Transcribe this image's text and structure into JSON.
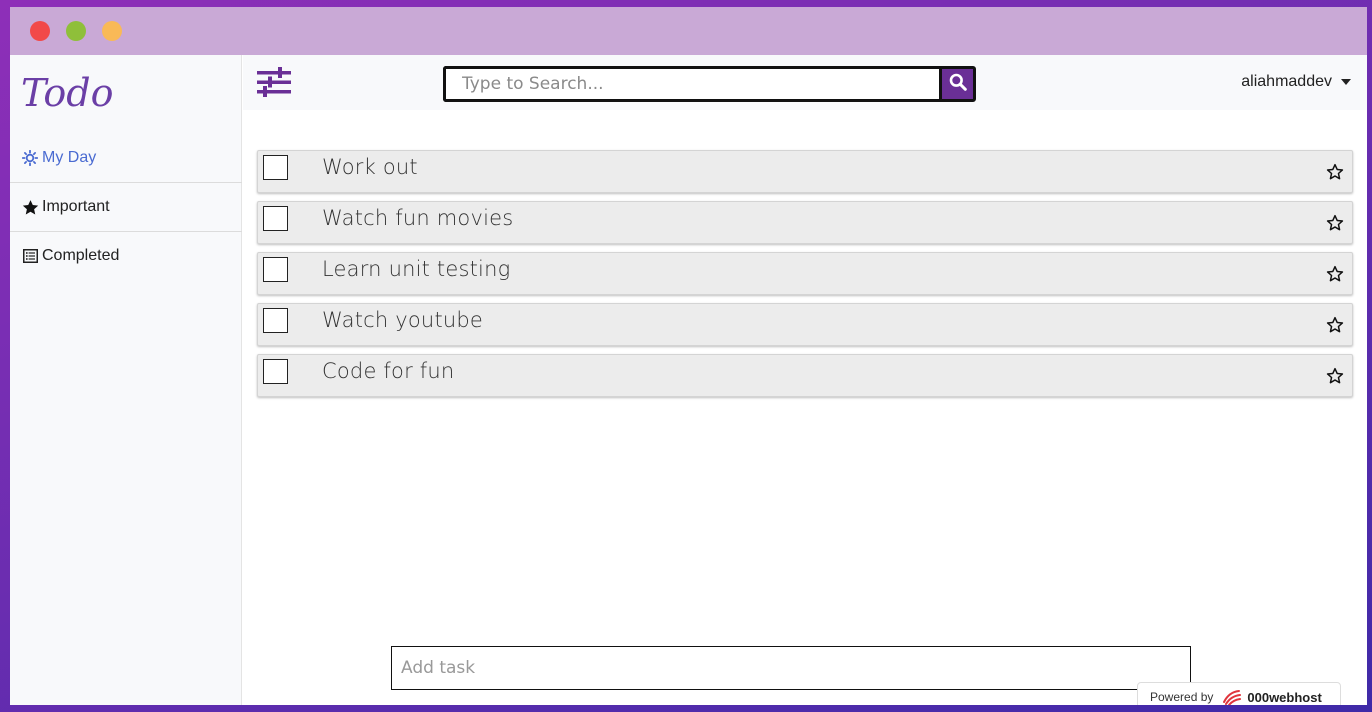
{
  "app": {
    "brand": "Todo",
    "accent_color": "#6a2f96"
  },
  "sidebar": {
    "items": [
      {
        "label": "My Day",
        "icon": "sun-icon",
        "active": true
      },
      {
        "label": "Important",
        "icon": "star-filled-icon",
        "active": false
      },
      {
        "label": "Completed",
        "icon": "list-icon",
        "active": false
      }
    ]
  },
  "topbar": {
    "filter_icon": "sliders-icon",
    "search": {
      "placeholder": "Type to Search...",
      "value": ""
    },
    "search_icon": "search-icon",
    "user": "aliahmaddev"
  },
  "tasks": [
    {
      "title": "Work out",
      "done": false,
      "important": false
    },
    {
      "title": "Watch fun movies",
      "done": false,
      "important": false
    },
    {
      "title": "Learn unit testing",
      "done": false,
      "important": false
    },
    {
      "title": "Watch youtube",
      "done": false,
      "important": false
    },
    {
      "title": "Code for fun",
      "done": false,
      "important": false
    }
  ],
  "add_task": {
    "placeholder": "Add task",
    "value": ""
  },
  "footer": {
    "powered_by": "Powered by",
    "host": "000webhost"
  }
}
